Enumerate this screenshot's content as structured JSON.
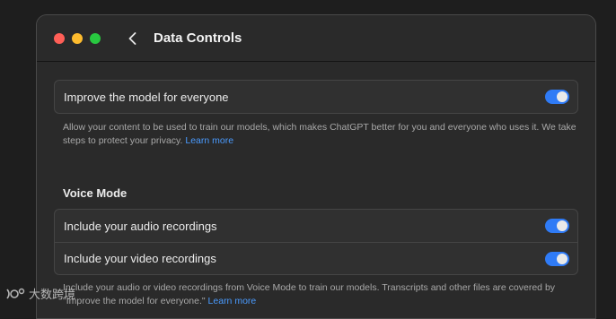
{
  "window": {
    "title": "Data Controls"
  },
  "improve": {
    "label": "Improve the model for everyone",
    "enabled": true,
    "description": "Allow your content to be used to train our models, which makes ChatGPT better for you and everyone who uses it. We take steps to protect your privacy.",
    "link": "Learn more"
  },
  "voice_mode": {
    "heading": "Voice Mode",
    "items": [
      {
        "label": "Include your audio recordings",
        "enabled": true
      },
      {
        "label": "Include your video recordings",
        "enabled": true
      }
    ],
    "description": "Include your audio or video recordings from Voice Mode to train our models. Transcripts and other files are covered by \"Improve the model for everyone.\"",
    "link": "Learn more"
  },
  "watermark": {
    "text": "大数跨境"
  },
  "colors": {
    "toggle_on": "#2f7bf6",
    "link": "#4a9bff"
  }
}
